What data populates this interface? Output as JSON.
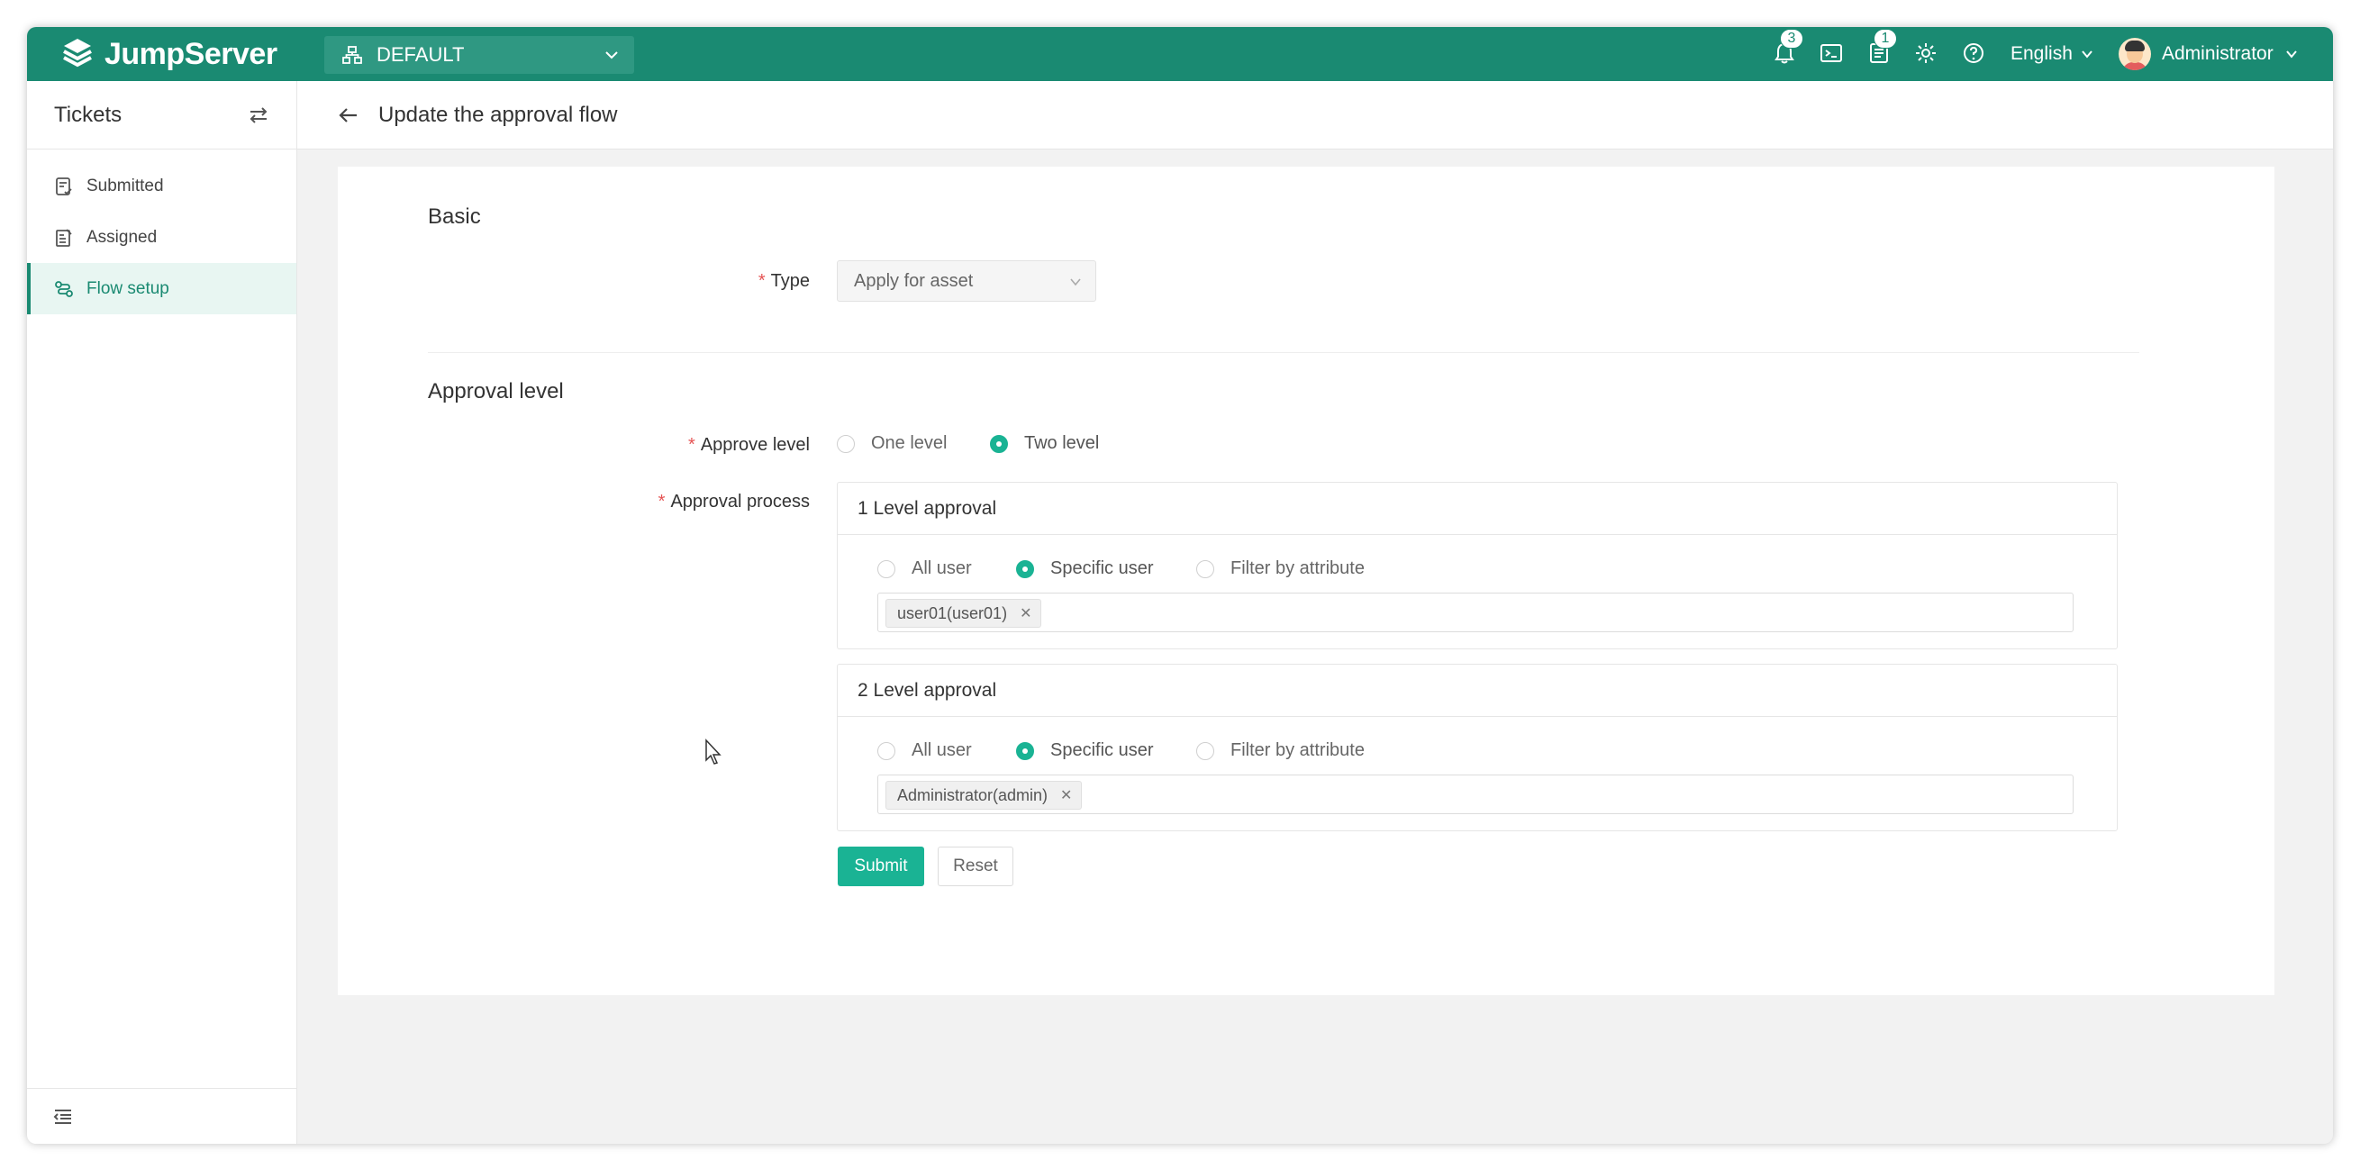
{
  "app": {
    "brand": "JumpServer"
  },
  "header": {
    "org": "DEFAULT",
    "notifications_count": "3",
    "tickets_count": "1",
    "language": "English",
    "user": "Administrator"
  },
  "sidebar": {
    "title": "Tickets",
    "items": [
      {
        "label": "Submitted",
        "icon": "ticket-submit-icon"
      },
      {
        "label": "Assigned",
        "icon": "ticket-assigned-icon"
      },
      {
        "label": "Flow setup",
        "icon": "flow-icon",
        "active": true
      }
    ]
  },
  "page": {
    "title": "Update the approval flow"
  },
  "form": {
    "basic": {
      "title": "Basic",
      "type_label": "Type",
      "type_value": "Apply for asset"
    },
    "approval": {
      "title": "Approval level",
      "approve_level_label": "Approve level",
      "level_options": [
        "One level",
        "Two level"
      ],
      "level_selected": "Two level",
      "process_label": "Approval process",
      "levels": [
        {
          "title": "1 Level approval",
          "options": [
            "All user",
            "Specific user",
            "Filter by attribute"
          ],
          "selected": "Specific user",
          "tag": "user01(user01)"
        },
        {
          "title": "2 Level approval",
          "options": [
            "All user",
            "Specific user",
            "Filter by attribute"
          ],
          "selected": "Specific user",
          "tag": "Administrator(admin)"
        }
      ]
    },
    "buttons": {
      "submit": "Submit",
      "reset": "Reset"
    }
  },
  "colors": {
    "primary": "#1a8a72",
    "accent": "#1ab394",
    "required": "#e55353"
  }
}
